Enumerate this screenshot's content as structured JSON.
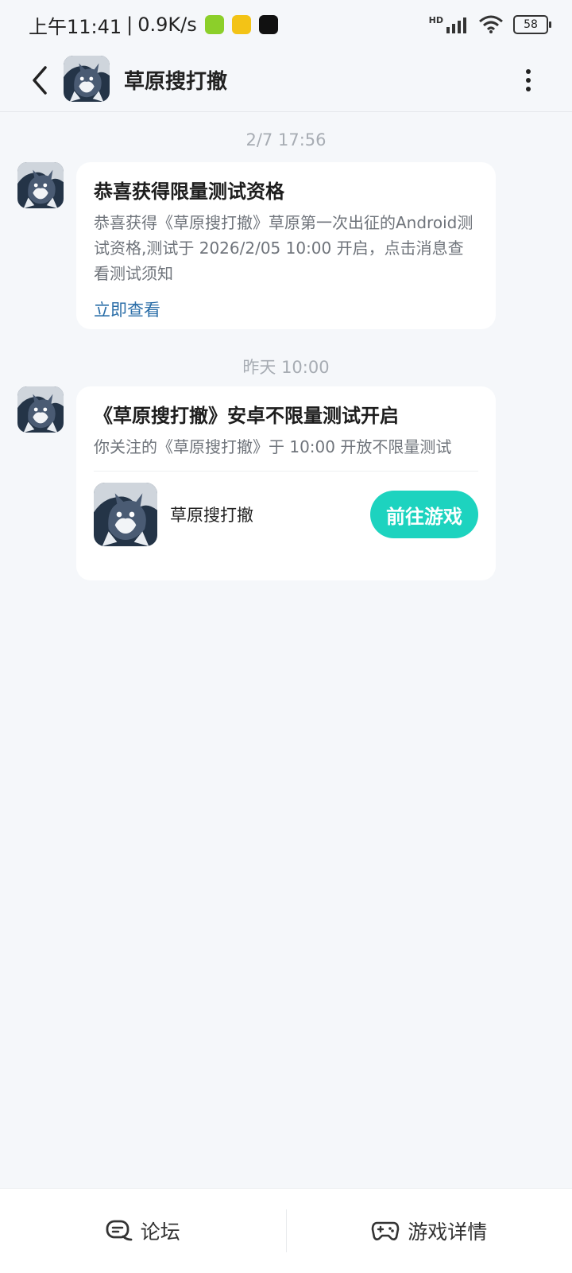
{
  "status_bar": {
    "time": "上午11:41",
    "speed": "0.9K/s",
    "network": "HD",
    "battery": "58"
  },
  "header": {
    "title": "草原搜打撤"
  },
  "messages": [
    {
      "timestamp": "2/7   17:56",
      "title": "恭喜获得限量测试资格",
      "body": "恭喜获得《草原搜打撤》草原第一次出征的Android测试资格,测试于 2026/2/05 10:00 开启，点击消息查看测试须知",
      "link": "立即查看"
    },
    {
      "timestamp": "昨天   10:00",
      "title": "《草原搜打撤》安卓不限量测试开启",
      "body": "你关注的《草原搜打撤》于 10:00 开放不限量测试",
      "game_name": "草原搜打撤",
      "button": "前往游戏"
    }
  ],
  "bottom_bar": {
    "forum": "论坛",
    "game_details": "游戏详情"
  },
  "colors": {
    "accent": "#1dd3bf",
    "link": "#2b6ea8",
    "background": "#f5f7fa"
  }
}
